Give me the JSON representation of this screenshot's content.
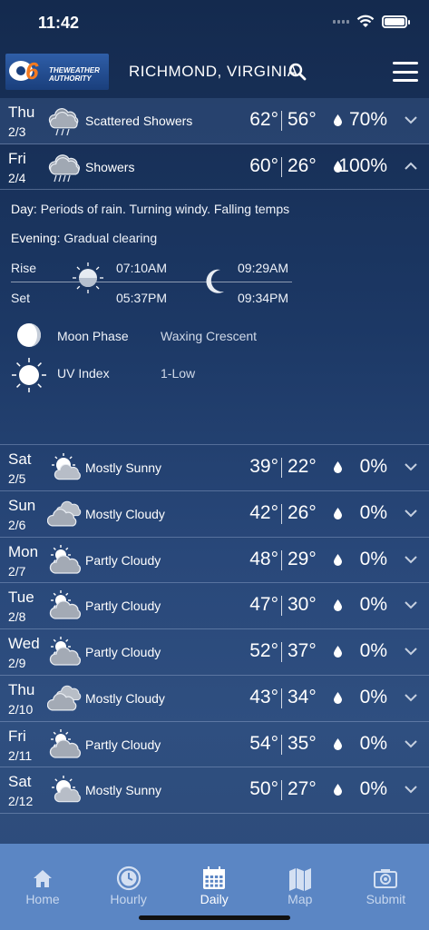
{
  "status_bar": {
    "time": "11:42"
  },
  "header": {
    "logo": "THEWEATHER AUTHORITY",
    "location": "RICHMOND, VIRGINIA"
  },
  "forecast": [
    {
      "day": "Thu",
      "date": "2/3",
      "icon": "scattered-showers-icon",
      "condition": "Scattered Showers",
      "high": "62°",
      "low": "56°",
      "precip": "70%",
      "expanded": false
    },
    {
      "day": "Fri",
      "date": "2/4",
      "icon": "showers-icon",
      "condition": "Showers",
      "high": "60°",
      "low": "26°",
      "precip": "100%",
      "expanded": true
    },
    {
      "day": "Sat",
      "date": "2/5",
      "icon": "mostly-sunny-icon",
      "condition": "Mostly Sunny",
      "high": "39°",
      "low": "22°",
      "precip": "0%"
    },
    {
      "day": "Sun",
      "date": "2/6",
      "icon": "mostly-cloudy-icon",
      "condition": "Mostly Cloudy",
      "high": "42°",
      "low": "26°",
      "precip": "0%"
    },
    {
      "day": "Mon",
      "date": "2/7",
      "icon": "partly-cloudy-icon",
      "condition": "Partly Cloudy",
      "high": "48°",
      "low": "29°",
      "precip": "0%"
    },
    {
      "day": "Tue",
      "date": "2/8",
      "icon": "partly-cloudy-icon",
      "condition": "Partly Cloudy",
      "high": "47°",
      "low": "30°",
      "precip": "0%"
    },
    {
      "day": "Wed",
      "date": "2/9",
      "icon": "partly-cloudy-icon",
      "condition": "Partly Cloudy",
      "high": "52°",
      "low": "37°",
      "precip": "0%"
    },
    {
      "day": "Thu",
      "date": "2/10",
      "icon": "mostly-cloudy-icon",
      "condition": "Mostly Cloudy",
      "high": "43°",
      "low": "34°",
      "precip": "0%"
    },
    {
      "day": "Fri",
      "date": "2/11",
      "icon": "partly-cloudy-icon",
      "condition": "Partly Cloudy",
      "high": "54°",
      "low": "35°",
      "precip": "0%"
    },
    {
      "day": "Sat",
      "date": "2/12",
      "icon": "mostly-sunny-icon",
      "condition": "Mostly Sunny",
      "high": "50°",
      "low": "27°",
      "precip": "0%"
    }
  ],
  "detail": {
    "day_label": "Day:",
    "day_text": "Periods of rain. Turning windy.  Falling temps",
    "evening_label": "Evening:",
    "evening_text": "Gradual clearing",
    "rise_label": "Rise",
    "set_label": "Set",
    "sunrise": "07:10AM",
    "sunset": "05:37PM",
    "moonrise": "09:29AM",
    "moonset": "09:34PM",
    "moon_phase_label": "Moon Phase",
    "moon_phase_value": "Waxing Crescent",
    "uv_label": "UV Index",
    "uv_value": "1-Low"
  },
  "tabs": [
    {
      "label": "Home",
      "icon": "home-icon",
      "active": false
    },
    {
      "label": "Hourly",
      "icon": "clock-icon",
      "active": false
    },
    {
      "label": "Daily",
      "icon": "calendar-icon",
      "active": true
    },
    {
      "label": "Map",
      "icon": "map-icon",
      "active": false
    },
    {
      "label": "Submit",
      "icon": "camera-icon",
      "active": false
    }
  ],
  "colors": {
    "tab_bar": "#5b86c4",
    "background": "#1c3865",
    "accent": "#f47a20"
  }
}
